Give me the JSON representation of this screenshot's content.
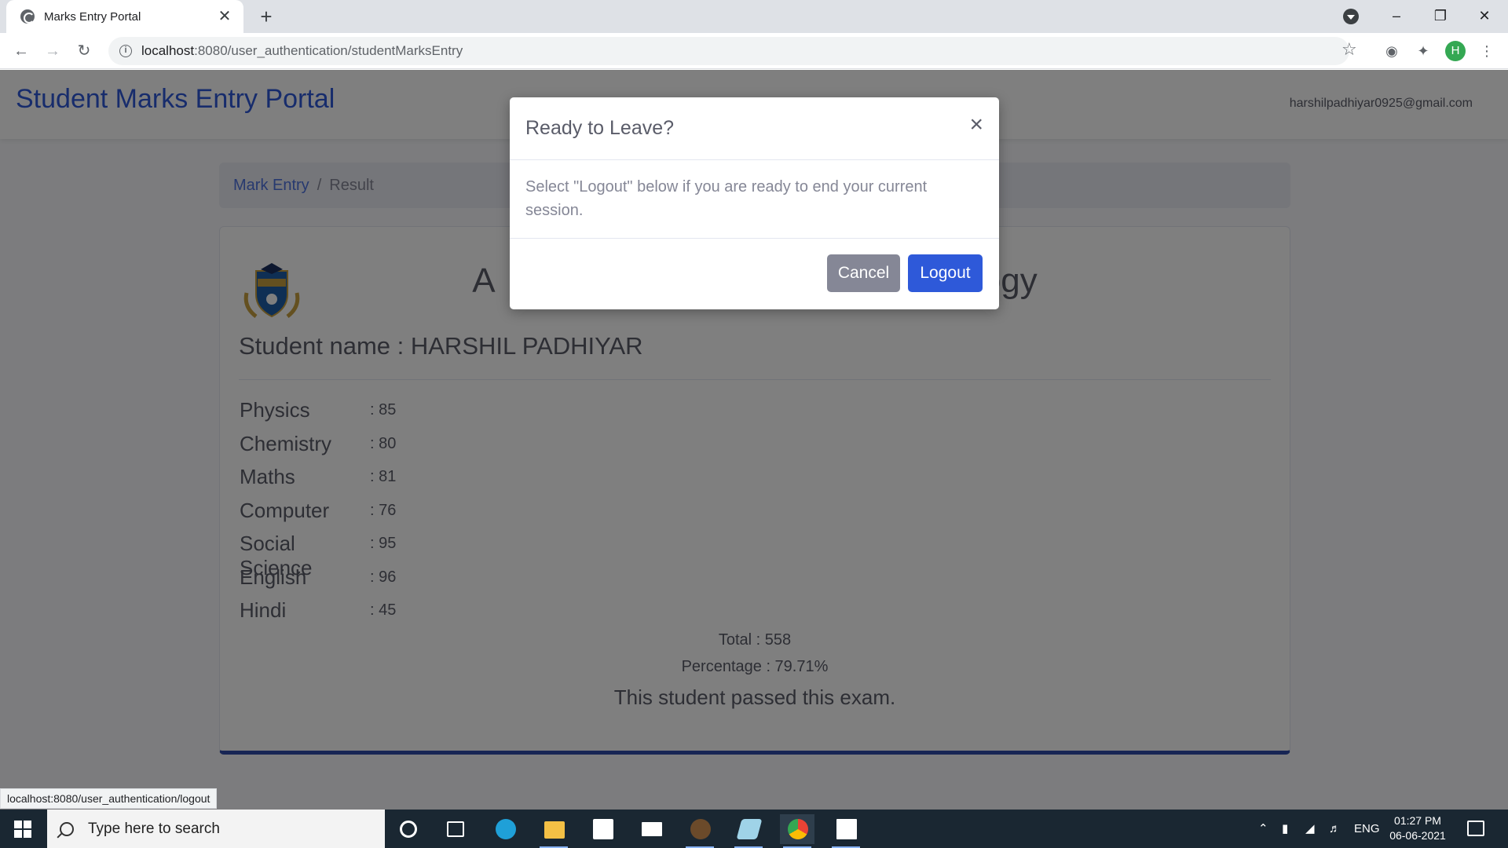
{
  "browser": {
    "tab_title": "Marks Entry Portal",
    "tab_close": "✕",
    "new_tab": "+",
    "url_host": "localhost",
    "url_path": ":8080/user_authentication/studentMarksEntry",
    "profile_initial": "H"
  },
  "navbar": {
    "brand": "Student Marks Entry Portal",
    "user_email": "harshilpadhiyar0925@gmail.com"
  },
  "breadcrumb": {
    "link": "Mark Entry",
    "separator": "/",
    "active": "Result"
  },
  "result_card": {
    "institute_name_left": "A",
    "institute_name_right": "ology",
    "student_name": "Student name : HARSHIL PADHIYAR",
    "marks": [
      {
        "subject": "Physics",
        "score": ": 85"
      },
      {
        "subject": "Chemistry",
        "score": ": 80"
      },
      {
        "subject": "Maths",
        "score": ": 81"
      },
      {
        "subject": "Computer",
        "score": ": 76"
      },
      {
        "subject": "Social Science",
        "score": ": 95"
      },
      {
        "subject": "English",
        "score": ": 96"
      },
      {
        "subject": "Hindi",
        "score": ": 45"
      }
    ],
    "total": "Total : 558",
    "percentage": "Percentage : 79.71%",
    "result": "This student passed this exam."
  },
  "modal": {
    "title": "Ready to Leave?",
    "close": "×",
    "body": "Select \"Logout\" below if you are ready to end your current session.",
    "cancel_label": "Cancel",
    "logout_label": "Logout"
  },
  "status_url": "localhost:8080/user_authentication/logout",
  "taskbar": {
    "search_placeholder": "Type here to search",
    "language": "ENG",
    "time": "01:27 PM",
    "date": "06-06-2021"
  },
  "colors": {
    "primary": "#4e73df",
    "primary_dark": "#2e59d9",
    "secondary": "#858796",
    "text": "#5a5c69"
  }
}
